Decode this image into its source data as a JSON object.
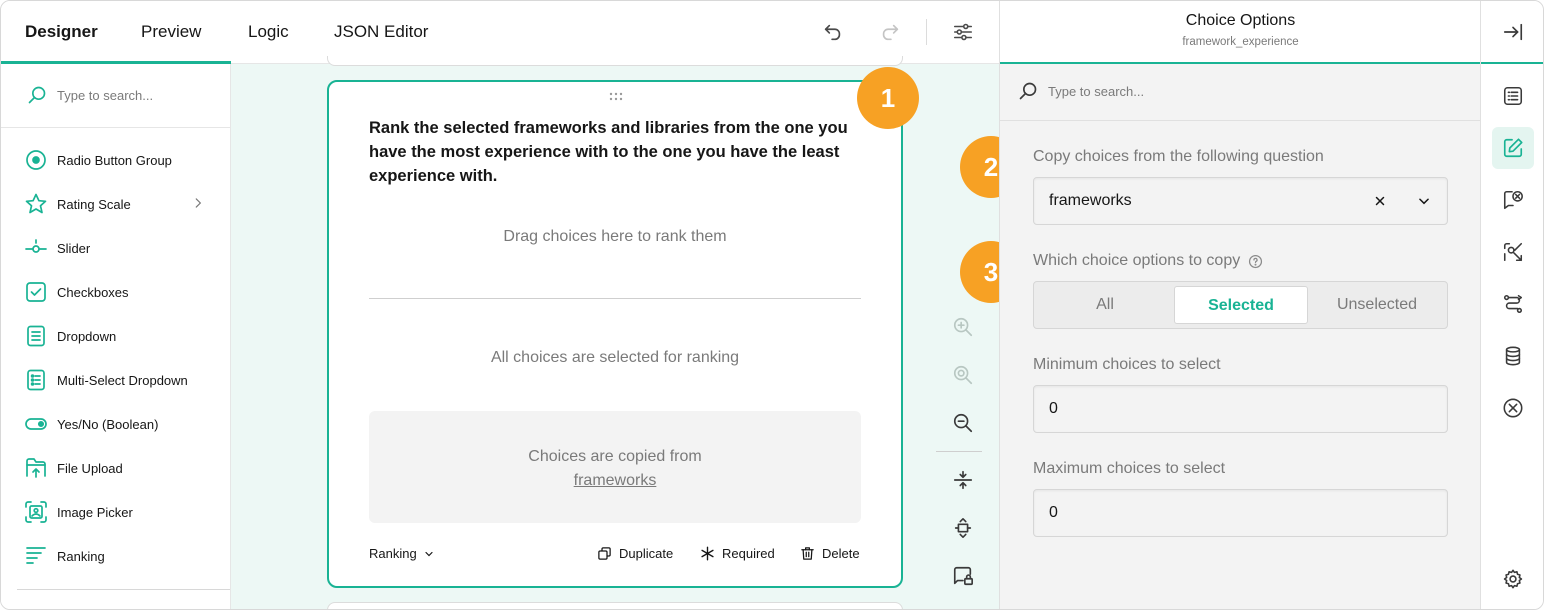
{
  "tabs": [
    {
      "label": "Designer",
      "active": true
    },
    {
      "label": "Preview",
      "active": false
    },
    {
      "label": "Logic",
      "active": false
    },
    {
      "label": "JSON Editor",
      "active": false
    }
  ],
  "toolbox": {
    "search_placeholder": "Type to search...",
    "items": [
      {
        "label": "Radio Button Group",
        "icon": "radio-button-group-icon"
      },
      {
        "label": "Rating Scale",
        "icon": "rating-scale-icon",
        "has_submenu": true
      },
      {
        "label": "Slider",
        "icon": "slider-icon"
      },
      {
        "label": "Checkboxes",
        "icon": "checkboxes-icon"
      },
      {
        "label": "Dropdown",
        "icon": "dropdown-icon"
      },
      {
        "label": "Multi-Select Dropdown",
        "icon": "multi-select-dropdown-icon"
      },
      {
        "label": "Yes/No (Boolean)",
        "icon": "boolean-icon"
      },
      {
        "label": "File Upload",
        "icon": "file-upload-icon"
      },
      {
        "label": "Image Picker",
        "icon": "image-picker-icon"
      },
      {
        "label": "Ranking",
        "icon": "ranking-icon"
      }
    ]
  },
  "question": {
    "title": "Rank the selected frameworks and libraries from the one you have the most experience with to the one you have the least experience with.",
    "drag_placeholder": "Drag choices here to rank them",
    "all_selected_text": "All choices are selected for ranking",
    "copied_from_text": "Choices are copied from",
    "copied_from_link": "frameworks",
    "type_label": "Ranking",
    "actions": {
      "duplicate": "Duplicate",
      "required": "Required",
      "delete": "Delete"
    }
  },
  "badges": [
    "1",
    "2",
    "3"
  ],
  "property_panel": {
    "title": "Choice Options",
    "subtitle": "framework_experience",
    "search_placeholder": "Type to search...",
    "copy_choices_label": "Copy choices from the following question",
    "copy_choices_value": "frameworks",
    "which_options_label": "Which choice options to copy",
    "segments": [
      {
        "label": "All",
        "active": false
      },
      {
        "label": "Selected",
        "active": true
      },
      {
        "label": "Unselected",
        "active": false
      }
    ],
    "min_label": "Minimum choices to select",
    "min_value": "0",
    "max_label": "Maximum choices to select",
    "max_value": "0"
  },
  "colors": {
    "accent": "#19b394",
    "badge": "#f7a124",
    "canvas_bg": "#edf8f5"
  }
}
